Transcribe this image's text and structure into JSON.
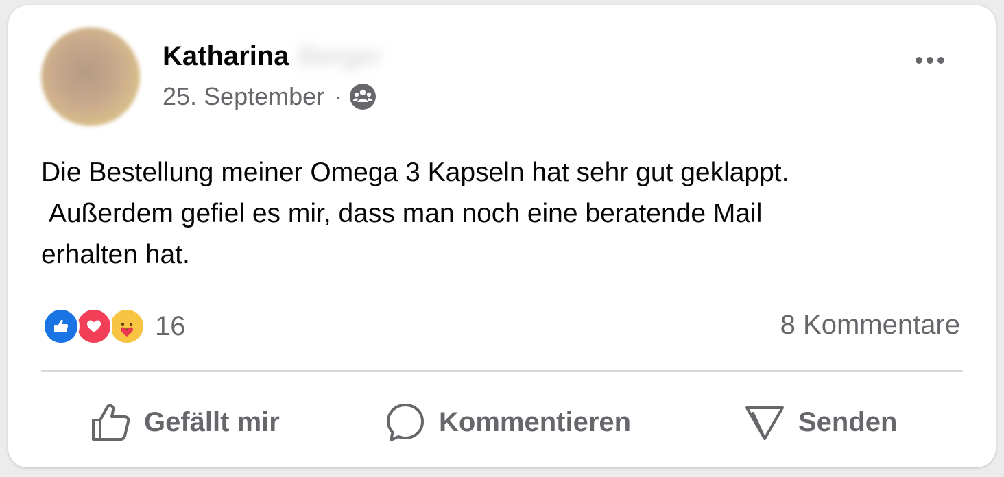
{
  "post": {
    "author_first_name": "Katharina",
    "author_last_name_blurred": "Berger",
    "date": "25. September",
    "separator": "·",
    "audience_icon": "friends-icon",
    "more_icon": "more-options-icon",
    "text": "Die Bestellung meiner Omega 3 Kapseln hat sehr gut geklappt.\n Außerdem gefiel es mir, dass man noch eine beratende Mail\nerhalten hat."
  },
  "reactions": {
    "icons": [
      "like-reaction-icon",
      "love-reaction-icon",
      "care-reaction-icon"
    ],
    "count": "16",
    "colors": {
      "like": "#1b74e4",
      "love": "#f33e58",
      "care": "#f7c542"
    }
  },
  "comments": {
    "label": "8 Kommentare"
  },
  "actions": {
    "like_label": "Gefällt mir",
    "comment_label": "Kommentieren",
    "send_label": "Senden"
  }
}
